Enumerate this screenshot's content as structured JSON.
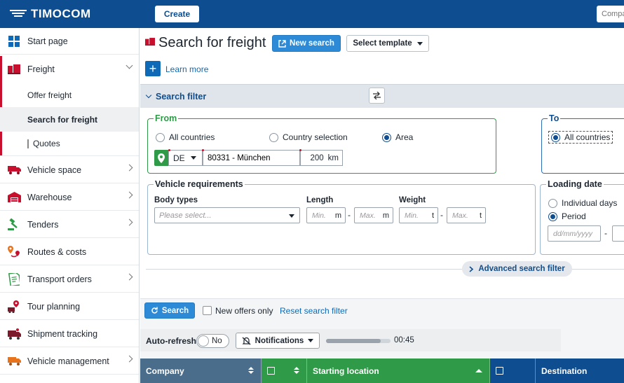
{
  "topbar": {
    "logo": "TIMOCOM",
    "create_label": "Create",
    "company_search_placeholder": "Compa"
  },
  "sidebar": {
    "items": [
      {
        "label": "Start page",
        "icon": "start-page-icon"
      },
      {
        "label": "Freight",
        "icon": "freight-icon"
      },
      {
        "label": "Vehicle space",
        "icon": "truck-icon"
      },
      {
        "label": "Warehouse",
        "icon": "warehouse-icon"
      },
      {
        "label": "Tenders",
        "icon": "gavel-icon"
      },
      {
        "label": "Routes & costs",
        "icon": "route-icon"
      },
      {
        "label": "Transport orders",
        "icon": "document-icon"
      },
      {
        "label": "Tour planning",
        "icon": "tour-planning-icon"
      },
      {
        "label": "Shipment tracking",
        "icon": "tracking-icon"
      },
      {
        "label": "Vehicle management",
        "icon": "vehicle-management-icon"
      }
    ],
    "freight_sub": [
      "Offer freight",
      "Search for freight",
      "Quotes"
    ]
  },
  "header": {
    "title": "Search for freight",
    "new_search": "New search",
    "select_template": "Select template",
    "learn_more": "Learn more"
  },
  "filter": {
    "title": "Search filter",
    "from": {
      "legend": "From",
      "options": [
        "All countries",
        "Country selection",
        "Area"
      ],
      "selected": "Area",
      "country": "DE",
      "zip": "80331 - München",
      "radius": "200",
      "radius_unit": "km"
    },
    "to": {
      "legend": "To",
      "option": "All countries"
    },
    "vehicle": {
      "legend": "Vehicle requirements",
      "body_types_label": "Body types",
      "body_types_placeholder": "Please select...",
      "length_label": "Length",
      "weight_label": "Weight",
      "min": "Min.",
      "max": "Max.",
      "length_unit": "m",
      "weight_unit": "t",
      "dash": "-"
    },
    "loading": {
      "legend": "Loading date",
      "options": [
        "Individual days",
        "Period"
      ],
      "selected": "Period",
      "date_placeholder": "dd/mm/yyyy",
      "dash": "-"
    },
    "advanced": "Advanced search filter"
  },
  "actions": {
    "search": "Search",
    "new_offers_only": "New offers only",
    "reset": "Reset search filter"
  },
  "refresh": {
    "label": "Auto-refresh",
    "toggle": "No",
    "notifications": "Notifications",
    "timer": "00:45",
    "progress": 0.85
  },
  "table": {
    "columns": [
      "Company",
      "",
      "Starting location",
      "",
      "Destination"
    ]
  },
  "colors": {
    "brand_blue": "#0e4d8f",
    "freight_red": "#c8102e",
    "green": "#2f9a47",
    "button_blue": "#2d8ad6"
  }
}
